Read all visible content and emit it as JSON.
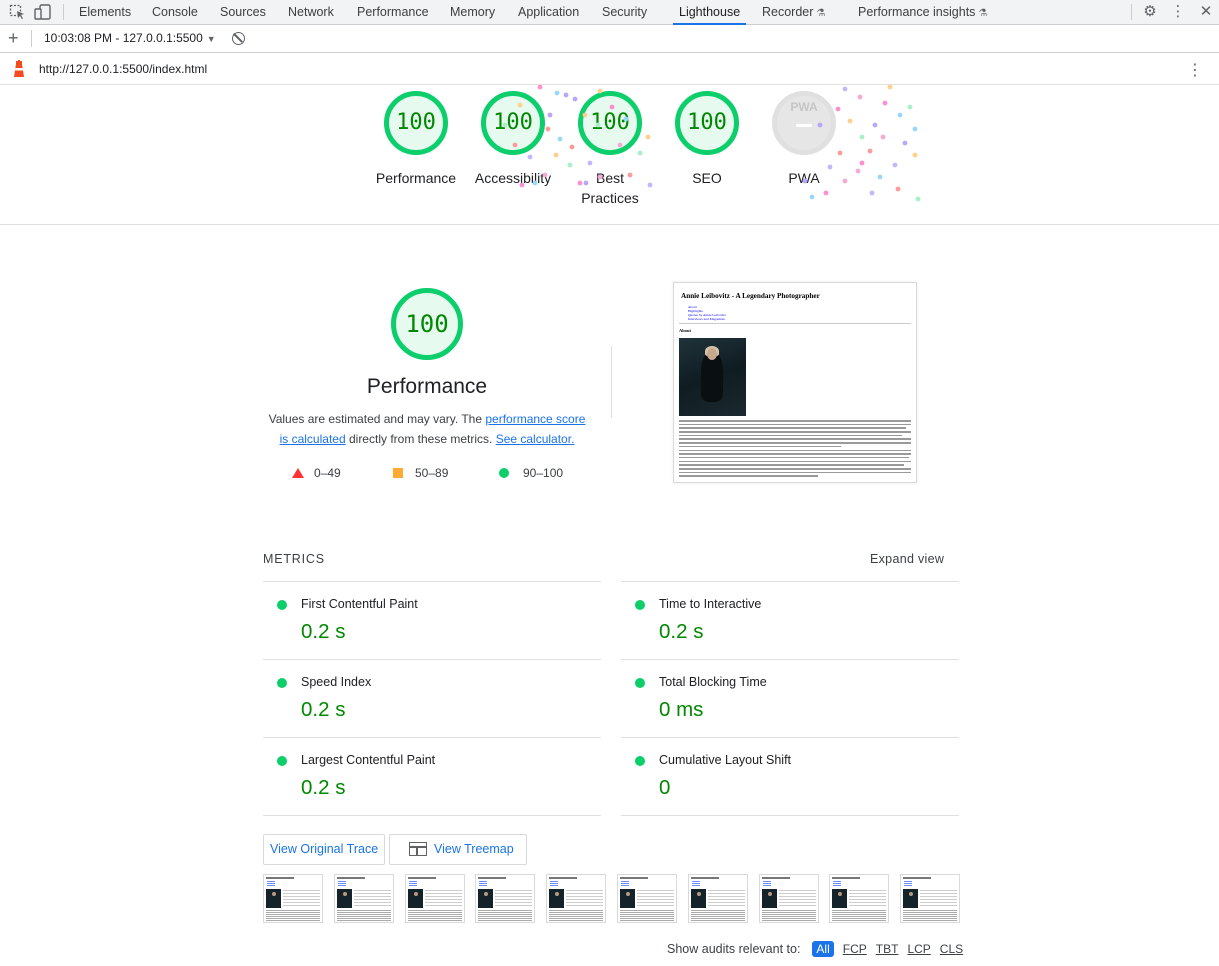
{
  "devtools": {
    "tabs": [
      {
        "label": "Elements"
      },
      {
        "label": "Console"
      },
      {
        "label": "Sources"
      },
      {
        "label": "Network"
      },
      {
        "label": "Performance"
      },
      {
        "label": "Memory"
      },
      {
        "label": "Application"
      },
      {
        "label": "Security"
      },
      {
        "label": "Lighthouse"
      },
      {
        "label": "Recorder"
      },
      {
        "label": "Performance insights"
      }
    ],
    "active_tab": "Lighthouse"
  },
  "lighthouse_toolbar": {
    "report_selector": "10:03:08 PM - 127.0.0.1:5500"
  },
  "url_bar": {
    "url": "http://127.0.0.1:5500/index.html"
  },
  "gauges": [
    {
      "label": "Performance",
      "score": "100"
    },
    {
      "label": "Accessibility",
      "score": "100"
    },
    {
      "label": "Best",
      "label2": "Practices",
      "score": "100"
    },
    {
      "label": "SEO",
      "score": "100"
    },
    {
      "label": "PWA",
      "badge": "PWA"
    }
  ],
  "performance": {
    "score": "100",
    "title": "Performance",
    "desc_prefix": "Values are estimated and may vary. The ",
    "desc_link1_a": "performance score",
    "desc_link1_b": "is calculated",
    "desc_middle": " directly from these metrics. ",
    "desc_link2": "See calculator.",
    "legend": {
      "fail": "0–49",
      "average": "50–89",
      "pass": "90–100"
    }
  },
  "final_screenshot": {
    "title": "Annie Leibovitz - A Legendary Photographer",
    "links": [
      "About",
      "Highlights",
      "Quotes by Annie Leibovitz",
      "Interviews and Magazines"
    ],
    "heading": "About"
  },
  "metrics": {
    "header": "METRICS",
    "expand_label": "Expand view",
    "items": [
      {
        "label": "First Contentful Paint",
        "value": "0.2 s"
      },
      {
        "label": "Time to Interactive",
        "value": "0.2 s"
      },
      {
        "label": "Speed Index",
        "value": "0.2 s"
      },
      {
        "label": "Total Blocking Time",
        "value": "0 ms"
      },
      {
        "label": "Largest Contentful Paint",
        "value": "0.2 s"
      },
      {
        "label": "Cumulative Layout Shift",
        "value": "0"
      }
    ]
  },
  "buttons": {
    "view_trace": "View Original Trace",
    "view_treemap": "View Treemap"
  },
  "audit_filter": {
    "label": "Show audits relevant to:",
    "chips": [
      "All",
      "FCP",
      "TBT",
      "LCP",
      "CLS"
    ],
    "active": "All"
  },
  "colors": {
    "pass": "#0cce6b",
    "pass_text": "#008800",
    "average": "#ffaa33",
    "fail": "#ff3333",
    "accent": "#1a73e8"
  }
}
